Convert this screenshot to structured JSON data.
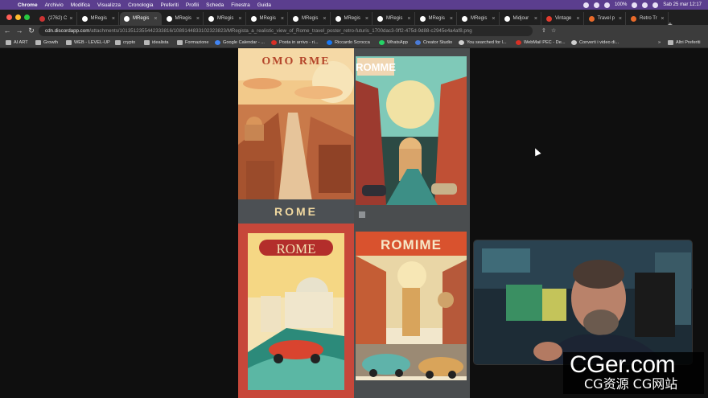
{
  "menubar": {
    "apple": "",
    "items": [
      "Chrome",
      "Archivio",
      "Modifica",
      "Visualizza",
      "Cronologia",
      "Preferiti",
      "Profili",
      "Scheda",
      "Finestra",
      "Guida"
    ],
    "battery": "100%",
    "datetime": "Sab 25 mar  12:17"
  },
  "tabs": [
    {
      "label": "(2762) C",
      "icon_color": "#cc3333"
    },
    {
      "label": "MRegis",
      "icon_color": "#ffffff"
    },
    {
      "label": "MRegis",
      "icon_color": "#ffffff"
    },
    {
      "label": "MRegis",
      "icon_color": "#ffffff"
    },
    {
      "label": "MRegis",
      "icon_color": "#ffffff"
    },
    {
      "label": "MRegis",
      "icon_color": "#ffffff"
    },
    {
      "label": "MRegis",
      "icon_color": "#ffffff"
    },
    {
      "label": "MRegis",
      "icon_color": "#ffffff"
    },
    {
      "label": "MRegis",
      "icon_color": "#ffffff"
    },
    {
      "label": "MRegis",
      "icon_color": "#ffffff"
    },
    {
      "label": "MRegis",
      "icon_color": "#ffffff"
    },
    {
      "label": "Midjour",
      "icon_color": "#ffffff"
    },
    {
      "label": "Vintage",
      "icon_color": "#e23b2e"
    },
    {
      "label": "Travel p",
      "icon_color": "#e86a2a"
    },
    {
      "label": "Retro Tr",
      "icon_color": "#e86a2a"
    }
  ],
  "active_tab_index": 2,
  "url": {
    "host": "cdn.discordapp.com",
    "path": "/attachments/1013512355442333816/1089144833102323823/MRegista_a_realistic_view_of_Rome_travel_poster_retro-futuris_1700dac3-0ff2-475d-9d88-c2945e4a4af8.png"
  },
  "bookmarks": [
    {
      "label": "AI ART",
      "icon": "folder"
    },
    {
      "label": "Growth",
      "icon": "folder"
    },
    {
      "label": "WEB - LEVEL-UP",
      "icon": "folder"
    },
    {
      "label": "crypto",
      "icon": "folder"
    },
    {
      "label": "idealista",
      "icon": "folder"
    },
    {
      "label": "Formazione",
      "icon": "folder"
    },
    {
      "label": "Google Calendar - ...",
      "icon": "calendar"
    },
    {
      "label": "Posta in arrivo - ri...",
      "icon": "mail"
    },
    {
      "label": "Riccardo Scrocca",
      "icon": "facebook"
    },
    {
      "label": "WhatsApp",
      "icon": "whatsapp"
    },
    {
      "label": "Creator Studio",
      "icon": "meta"
    },
    {
      "label": "You searched for l...",
      "icon": "doc"
    },
    {
      "label": "WebMail PEC - De...",
      "icon": "mail"
    },
    {
      "label": "Converti i video di...",
      "icon": "doc"
    },
    {
      "label": "Altri Preferiti",
      "icon": "folder"
    }
  ],
  "posters": [
    {
      "title": "OMO RME",
      "caption": "ROME",
      "colors": {
        "bg": "#f2c98a",
        "accent": "#b4452a",
        "band": "#4c5054"
      }
    },
    {
      "title": "ROMME",
      "caption": "",
      "colors": {
        "bg": "#2c4a44",
        "accent": "#d94a33",
        "band": "#4a4d4f"
      }
    },
    {
      "title": "ROME",
      "caption": "",
      "colors": {
        "bg": "#f4e3b4",
        "accent": "#b32e2b",
        "band": "#c7473a"
      }
    },
    {
      "title": "ROMIME",
      "caption": "",
      "colors": {
        "bg": "#f2e7cc",
        "accent": "#d9522e",
        "band": "#4a4d4f"
      }
    }
  ],
  "watermark": {
    "title": "CGer.com",
    "subtitle": "CG资源 CG网站"
  }
}
